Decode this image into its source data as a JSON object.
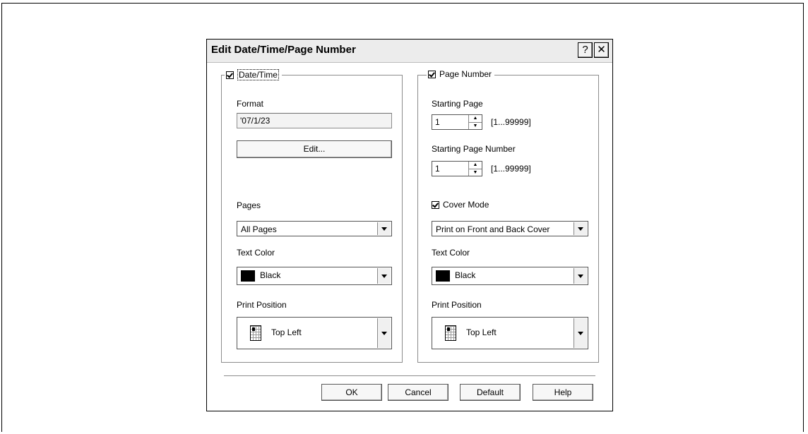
{
  "dialog": {
    "title": "Edit Date/Time/Page Number",
    "help_glyph": "?",
    "close_glyph": "✕"
  },
  "datetime": {
    "legend": "Date/Time",
    "checked": true,
    "format_label": "Format",
    "format_value": "'07/1/23",
    "edit_button": "Edit...",
    "pages_label": "Pages",
    "pages_value": "All Pages",
    "text_color_label": "Text Color",
    "text_color_value": "Black",
    "print_position_label": "Print Position",
    "print_position_value": "Top Left"
  },
  "page_number": {
    "legend": "Page Number",
    "checked": true,
    "starting_page_label": "Starting Page",
    "starting_page_value": "1",
    "starting_page_range": "[1...99999]",
    "starting_number_label": "Starting Page Number",
    "starting_number_value": "1",
    "starting_number_range": "[1...99999]",
    "cover_mode_label": "Cover Mode",
    "cover_mode_checked": true,
    "cover_mode_value": "Print on Front and Back Cover",
    "text_color_label": "Text Color",
    "text_color_value": "Black",
    "print_position_label": "Print Position",
    "print_position_value": "Top Left"
  },
  "buttons": {
    "ok": "OK",
    "cancel": "Cancel",
    "default": "Default",
    "help": "Help"
  },
  "colors": {
    "swatch": "#000000",
    "dialog_bg": "#ffffff",
    "border": "#000000"
  }
}
